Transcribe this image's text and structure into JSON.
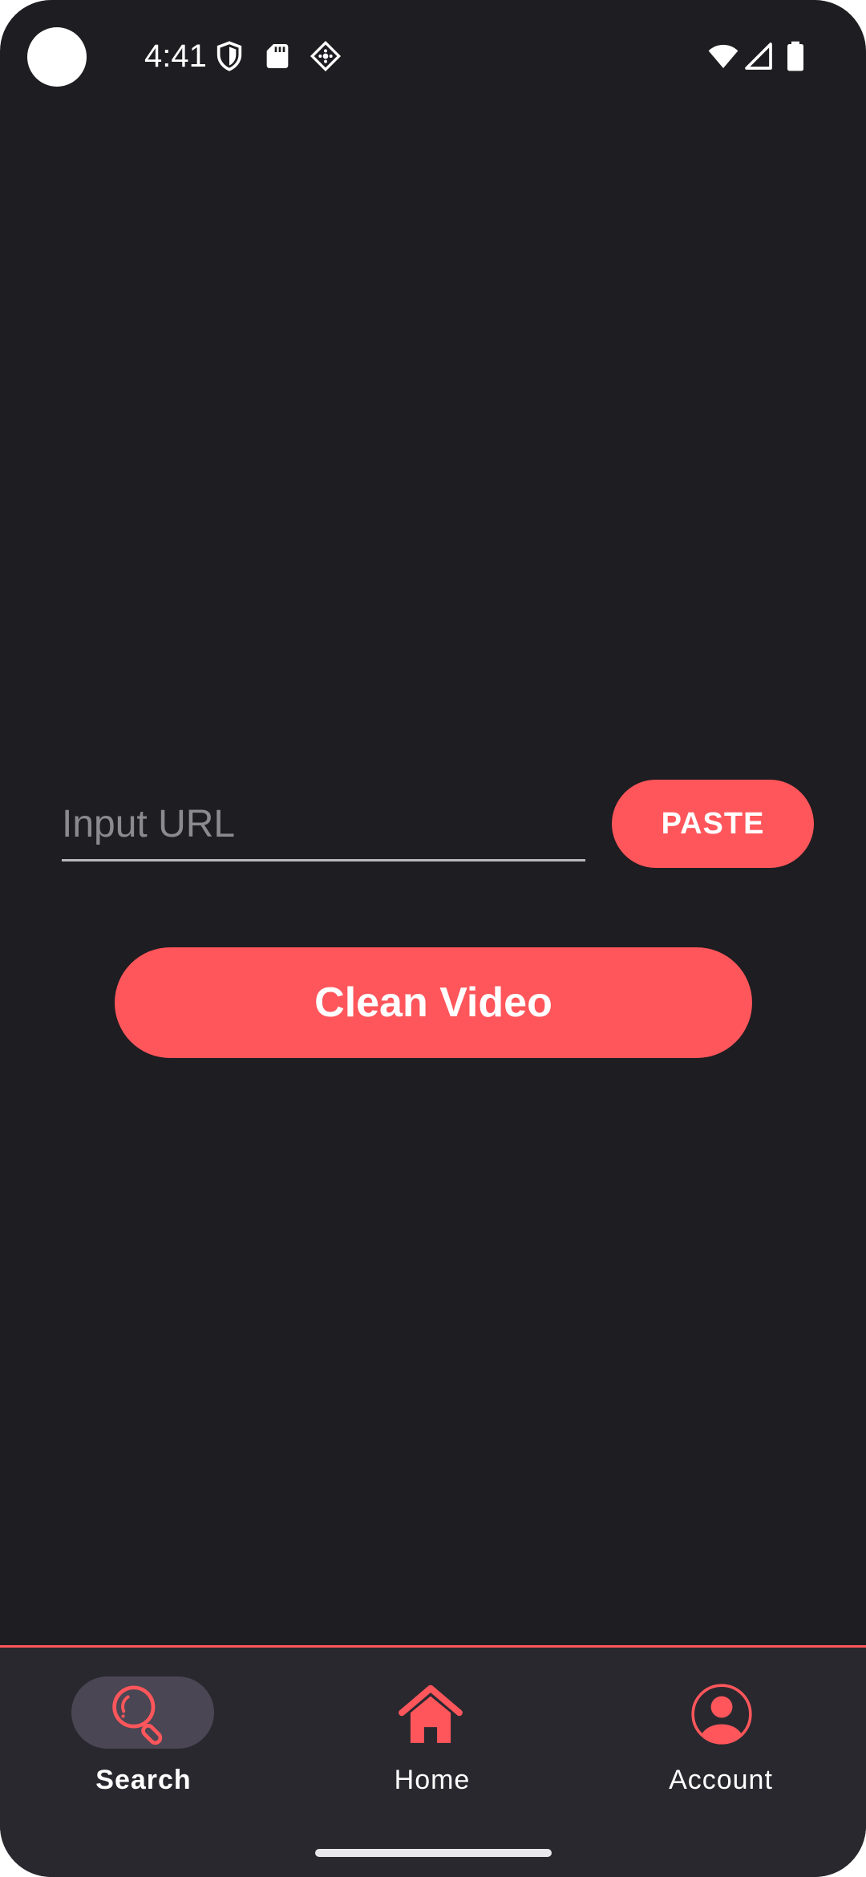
{
  "status_bar": {
    "time": "4:41",
    "icons": [
      "shield-icon",
      "sd-card-icon",
      "location-icon",
      "wifi-icon",
      "signal-icon",
      "battery-icon"
    ]
  },
  "main": {
    "url_input": {
      "placeholder": "Input URL",
      "value": ""
    },
    "paste_label": "PASTE",
    "clean_label": "Clean Video"
  },
  "bottom_nav": {
    "items": [
      {
        "label": "Search",
        "icon": "search-icon",
        "active": true
      },
      {
        "label": "Home",
        "icon": "home-icon",
        "active": false
      },
      {
        "label": "Account",
        "icon": "account-icon",
        "active": false
      }
    ]
  },
  "colors": {
    "background": "#1e1d21",
    "accent": "#fe565b",
    "nav_background": "#29282f",
    "active_pill": "#4a4653"
  }
}
